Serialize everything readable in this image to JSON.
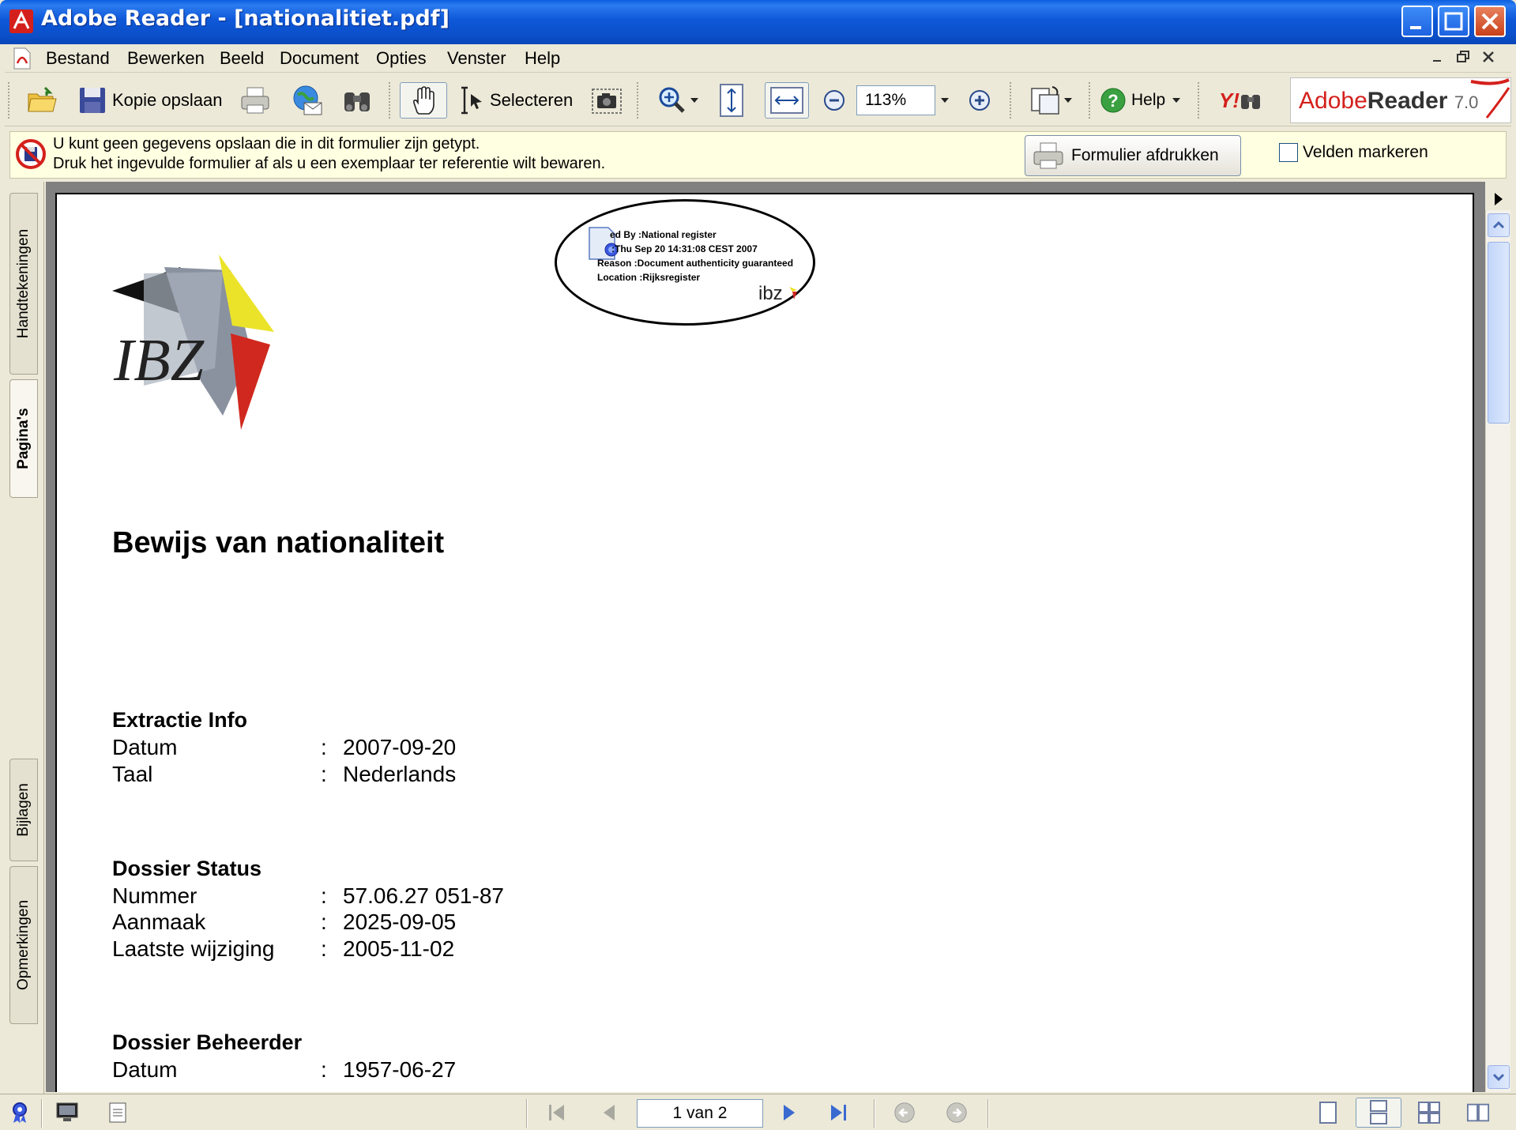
{
  "window": {
    "title": "Adobe Reader - [nationalitiet.pdf]"
  },
  "menu": {
    "items": [
      "Bestand",
      "Bewerken",
      "Beeld",
      "Document",
      "Opties",
      "Venster",
      "Help"
    ]
  },
  "toolbar": {
    "save_copy_label": "Kopie opslaan",
    "select_label": "Selecteren",
    "zoom_value": "113%",
    "help_label": "Help",
    "yahoo_label": "Y!",
    "brand_adobe": "Adobe",
    "brand_reader": "Reader",
    "brand_version": "7.0"
  },
  "message_bar": {
    "line1": "U kunt geen gegevens opslaan die in dit formulier zijn getypt.",
    "line2": "Druk het ingevulde formulier af als u een exemplaar ter referentie wilt bewaren.",
    "print_form_label": "Formulier afdrukken",
    "mark_fields_label": "Velden markeren",
    "mark_fields_checked": false
  },
  "nav_tabs": [
    "Handtekeningen",
    "Pagina's",
    "Bijlagen",
    "Opmerkingen"
  ],
  "document": {
    "logo_text": "IBZ",
    "signature": {
      "line1": "ed By :National register",
      "line2": ":Thu Sep 20 14:31:08 CEST 2007",
      "line3": "Reason :Document authenticity guaranteed",
      "line4": "Location :Rijksregister",
      "mark": "ibz"
    },
    "title": "Bewijs van nationaliteit",
    "sections": [
      {
        "heading": "Extractie Info",
        "rows": [
          {
            "label": "Datum",
            "value": "2007-09-20"
          },
          {
            "label": "Taal",
            "value": "Nederlands"
          }
        ]
      },
      {
        "heading": "Dossier Status",
        "rows": [
          {
            "label": "Nummer",
            "value": "57.06.27 051-87"
          },
          {
            "label": "Aanmaak",
            "value": "2025-09-05"
          },
          {
            "label": "Laatste wijziging",
            "value": "2005-11-02"
          }
        ]
      },
      {
        "heading": "Dossier Beheerder",
        "rows": [
          {
            "label": "Datum",
            "value": "1957-06-27"
          }
        ]
      }
    ],
    "colon": ":"
  },
  "status_bar": {
    "page_indicator": "1 van 2"
  },
  "colors": {
    "titlebar": "#0B4FC9",
    "adobe_red": "#D4201C",
    "message_bg": "#FFFFE1",
    "doc_bg": "#808080"
  }
}
